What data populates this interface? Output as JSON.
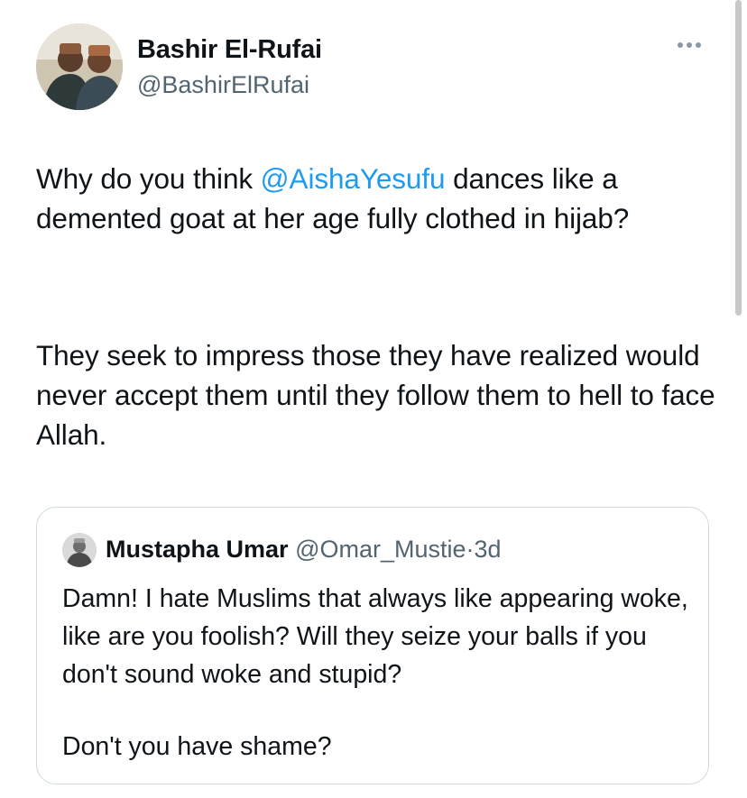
{
  "author": {
    "name": "Bashir El-Rufai",
    "handle": "@BashirElRufai"
  },
  "tweet": {
    "p1_before": "Why do you think ",
    "p1_mention": "@AishaYesufu",
    "p1_after": " dances like a demented goat at her age fully clothed in hijab?",
    "p2": "They seek to impress those they have realized would never accept them until they follow them to hell to face Allah."
  },
  "quote": {
    "name": "Mustapha Umar",
    "handle": "@Omar_Mustie",
    "separator": "·",
    "time": "3d",
    "p1": "Damn! I hate Muslims that always like appearing woke, like are you foolish? Will they seize your balls if you don't sound woke and stupid?",
    "p2": "Don't you have shame?"
  },
  "icons": {
    "more": "more-horizontal-icon"
  },
  "colors": {
    "text": "#0f1419",
    "secondary": "#536471",
    "link": "#1d9bf0",
    "border": "#cfd9de"
  }
}
